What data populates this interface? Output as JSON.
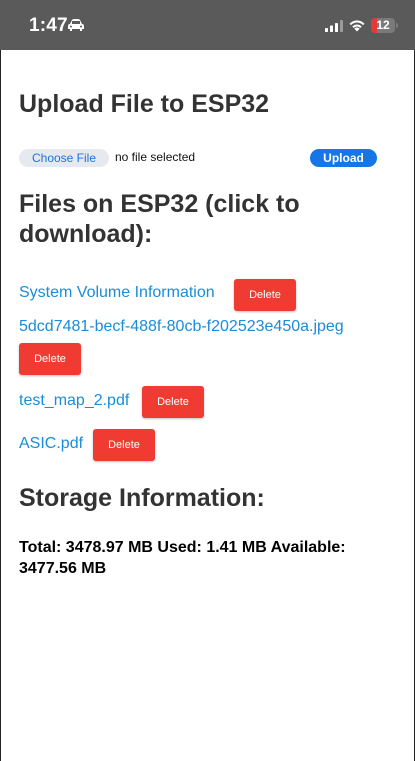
{
  "status_bar": {
    "time": "1:47",
    "battery_level": "12",
    "battery_fraction": 0.12,
    "icons": [
      "car-icon",
      "signal-icon",
      "wifi-icon",
      "battery-icon"
    ],
    "background_color": "#5a5a5a",
    "battery_color": "#e53935"
  },
  "upload": {
    "title": "Upload File to ESP32",
    "choose_label": "Choose File",
    "file_status": "no file selected",
    "upload_label": "Upload",
    "upload_color": "#1676e6"
  },
  "files": {
    "heading": "Files on ESP32 (click to download):",
    "delete_label": "Delete",
    "delete_color": "#ef3b32",
    "link_color": "#1a8cd8",
    "items": [
      {
        "name": "System Volume Information"
      },
      {
        "name": "5dcd7481-becf-488f-80cb-f202523e450a.jpeg"
      },
      {
        "name": "test_map_2.pdf"
      },
      {
        "name": "ASIC.pdf"
      }
    ]
  },
  "storage": {
    "heading": "Storage Information:",
    "summary": "Total: 3478.97 MB Used: 1.41 MB Available: 3477.56 MB"
  }
}
